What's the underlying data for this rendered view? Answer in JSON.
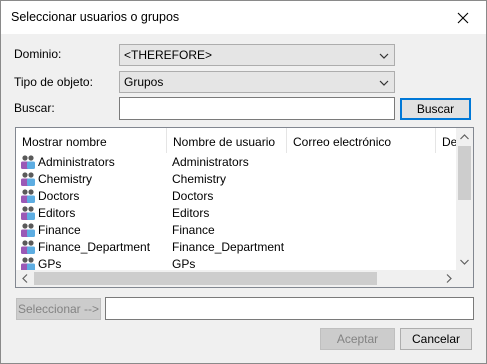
{
  "window": {
    "title": "Seleccionar usuarios o grupos"
  },
  "form": {
    "domain_label": "Dominio:",
    "domain_value": "<THEREFORE>",
    "object_type_label": "Tipo de objeto:",
    "object_type_value": "Grupos",
    "search_label": "Buscar:",
    "search_value": "",
    "search_button": "Buscar"
  },
  "list": {
    "columns": [
      "Mostrar nombre",
      "Nombre de usuario",
      "Correo electrónico",
      "Des"
    ],
    "rows": [
      {
        "display": "Administrators",
        "user": "Administrators",
        "icon": "group-icon"
      },
      {
        "display": "Chemistry",
        "user": "Chemistry",
        "icon": "group-icon"
      },
      {
        "display": "Doctors",
        "user": "Doctors",
        "icon": "group-icon"
      },
      {
        "display": "Editors",
        "user": "Editors",
        "icon": "group-icon"
      },
      {
        "display": "Finance",
        "user": "Finance",
        "icon": "group-icon"
      },
      {
        "display": "Finance_Department",
        "user": "Finance_Department",
        "icon": "group-icon"
      },
      {
        "display": "GPs",
        "user": "GPs",
        "icon": "group-icon"
      }
    ]
  },
  "selection": {
    "select_button": "Seleccionar -->",
    "selected_value": ""
  },
  "footer": {
    "accept_button": "Aceptar",
    "cancel_button": "Cancelar"
  },
  "colors": {
    "accent": "#0078d7",
    "dialog_bg": "#f0f0f0"
  }
}
